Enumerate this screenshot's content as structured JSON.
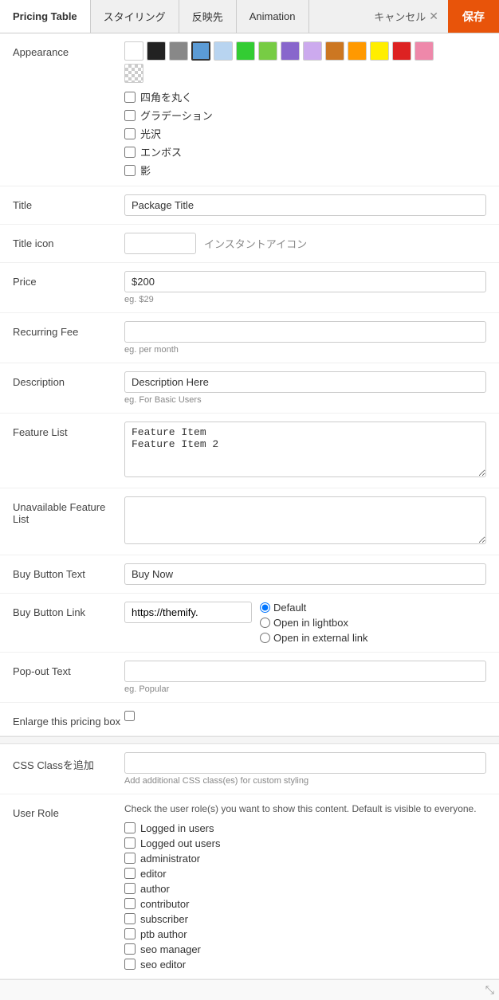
{
  "header": {
    "tabs": [
      {
        "id": "pricing-table",
        "label": "Pricing Table",
        "active": true
      },
      {
        "id": "styling",
        "label": "スタイリング",
        "active": false
      },
      {
        "id": "reflection",
        "label": "反映先",
        "active": false
      },
      {
        "id": "animation",
        "label": "Animation",
        "active": false
      }
    ],
    "cancel_label": "キャンセル",
    "save_label": "保存"
  },
  "appearance": {
    "label": "Appearance",
    "swatches": [
      {
        "color": "#ffffff",
        "id": "white"
      },
      {
        "color": "#222222",
        "id": "black"
      },
      {
        "color": "#888888",
        "id": "gray"
      },
      {
        "color": "#5b9bd5",
        "id": "blue",
        "selected": true
      },
      {
        "color": "#b8d4f0",
        "id": "light-blue"
      },
      {
        "color": "#33cc33",
        "id": "green"
      },
      {
        "color": "#77cc44",
        "id": "light-green"
      },
      {
        "color": "#8866cc",
        "id": "purple"
      },
      {
        "color": "#ccaaee",
        "id": "light-purple"
      },
      {
        "color": "#cc7722",
        "id": "brown"
      },
      {
        "color": "#ff9900",
        "id": "orange"
      },
      {
        "color": "#ffee00",
        "id": "yellow"
      },
      {
        "color": "#dd2222",
        "id": "red"
      },
      {
        "color": "#ee88aa",
        "id": "pink"
      },
      {
        "color": null,
        "id": "checkered"
      }
    ],
    "options": [
      {
        "id": "rounded",
        "label": "四角を丸く"
      },
      {
        "id": "gradient",
        "label": "グラデーション"
      },
      {
        "id": "gloss",
        "label": "光沢"
      },
      {
        "id": "emboss",
        "label": "エンボス"
      },
      {
        "id": "shadow",
        "label": "影"
      }
    ]
  },
  "fields": {
    "title": {
      "label": "Title",
      "value": "Package Title",
      "placeholder": ""
    },
    "title_icon": {
      "label": "Title icon",
      "value": "",
      "placeholder": "",
      "instant_icon_label": "インスタントアイコン"
    },
    "price": {
      "label": "Price",
      "value": "$200",
      "hint": "eg. $29"
    },
    "recurring_fee": {
      "label": "Recurring Fee",
      "value": "",
      "hint": "eg. per month"
    },
    "description": {
      "label": "Description",
      "value": "Description Here",
      "hint": "eg. For Basic Users"
    },
    "feature_list": {
      "label": "Feature List",
      "value": "Feature Item\nFeature Item 2"
    },
    "unavailable_feature_list": {
      "label": "Unavailable Feature List",
      "value": ""
    },
    "buy_button_text": {
      "label": "Buy Button Text",
      "value": "Buy Now"
    },
    "buy_button_link": {
      "label": "Buy Button Link",
      "value": "https://themify.",
      "radio_options": [
        {
          "id": "default",
          "label": "Default",
          "checked": true
        },
        {
          "id": "lightbox",
          "label": "Open in lightbox",
          "checked": false
        },
        {
          "id": "external",
          "label": "Open in external link",
          "checked": false
        }
      ]
    },
    "popout_text": {
      "label": "Pop-out Text",
      "value": "",
      "hint": "eg. Popular"
    },
    "enlarge": {
      "label": "Enlarge this pricing box",
      "checked": false
    },
    "css_class": {
      "label": "CSS Classを追加",
      "value": "",
      "hint": "Add additional CSS class(es) for custom styling"
    },
    "user_role": {
      "label": "User Role",
      "description": "Check the user role(s) you want to show this content. Default is visible to everyone.",
      "roles": [
        {
          "id": "logged_in",
          "label": "Logged in users",
          "checked": false
        },
        {
          "id": "logged_out",
          "label": "Logged out users",
          "checked": false
        },
        {
          "id": "administrator",
          "label": "administrator",
          "checked": false
        },
        {
          "id": "editor",
          "label": "editor",
          "checked": false
        },
        {
          "id": "author",
          "label": "author",
          "checked": false
        },
        {
          "id": "contributor",
          "label": "contributor",
          "checked": false
        },
        {
          "id": "subscriber",
          "label": "subscriber",
          "checked": false
        },
        {
          "id": "ptb_author",
          "label": "ptb author",
          "checked": false
        },
        {
          "id": "seo_manager",
          "label": "seo manager",
          "checked": false
        },
        {
          "id": "seo_editor",
          "label": "seo editor",
          "checked": false
        }
      ]
    }
  }
}
